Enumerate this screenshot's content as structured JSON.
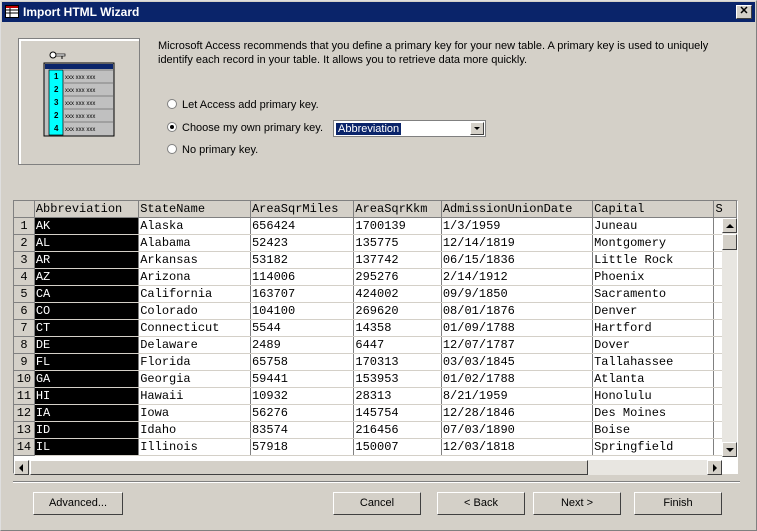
{
  "window": {
    "title": "Import HTML Wizard",
    "close_glyph": "✕"
  },
  "message": "Microsoft Access recommends that you define a primary key for your new table. A primary key is used to uniquely identify each record in your table. It allows you to retrieve data more quickly.",
  "options": {
    "let_access": "Let Access add primary key.",
    "choose_own": "Choose my own primary key.",
    "no_key": "No primary key.",
    "selected": "choose_own",
    "key_field": "Abbreviation"
  },
  "illustration": {
    "row_numbers": [
      "1",
      "2",
      "3",
      "2",
      "4"
    ],
    "cell_text": "xxx xxx xxx"
  },
  "grid": {
    "columns": [
      "Abbreviation",
      "StateName",
      "AreaSqrMiles",
      "AreaSqrKkm",
      "AdmissionUnionDate",
      "Capital",
      "S"
    ],
    "rows": [
      [
        "1",
        "AK",
        "Alaska",
        "656424",
        "1700139",
        "1/3/1959",
        "Juneau"
      ],
      [
        "2",
        "AL",
        "Alabama",
        "52423",
        "135775",
        "12/14/1819",
        "Montgomery"
      ],
      [
        "3",
        "AR",
        "Arkansas",
        "53182",
        "137742",
        "06/15/1836",
        "Little Rock"
      ],
      [
        "4",
        "AZ",
        "Arizona",
        "114006",
        "295276",
        "2/14/1912",
        "Phoenix"
      ],
      [
        "5",
        "CA",
        "California",
        "163707",
        "424002",
        "09/9/1850",
        "Sacramento"
      ],
      [
        "6",
        "CO",
        "Colorado",
        "104100",
        "269620",
        "08/01/1876",
        "Denver"
      ],
      [
        "7",
        "CT",
        "Connecticut",
        "5544",
        "14358",
        "01/09/1788",
        "Hartford"
      ],
      [
        "8",
        "DE",
        "Delaware",
        "2489",
        "6447",
        "12/07/1787",
        "Dover"
      ],
      [
        "9",
        "FL",
        "Florida",
        "65758",
        "170313",
        "03/03/1845",
        "Tallahassee"
      ],
      [
        "10",
        "GA",
        "Georgia",
        "59441",
        "153953",
        "01/02/1788",
        "Atlanta"
      ],
      [
        "11",
        "HI",
        "Hawaii",
        "10932",
        "28313",
        "8/21/1959",
        "Honolulu"
      ],
      [
        "12",
        "IA",
        "Iowa",
        "56276",
        "145754",
        "12/28/1846",
        "Des Moines"
      ],
      [
        "13",
        "ID",
        "Idaho",
        "83574",
        "216456",
        "07/03/1890",
        "Boise"
      ],
      [
        "14",
        "IL",
        "Illinois",
        "57918",
        "150007",
        "12/03/1818",
        "Springfield"
      ]
    ]
  },
  "buttons": {
    "advanced": "Advanced...",
    "cancel": "Cancel",
    "back": "< Back",
    "next": "Next >",
    "finish": "Finish"
  },
  "colors": {
    "title_bar": "#0a246a",
    "face": "#d4d0c8",
    "selection": "#000000",
    "illustration_cyan": "#00ffff"
  }
}
